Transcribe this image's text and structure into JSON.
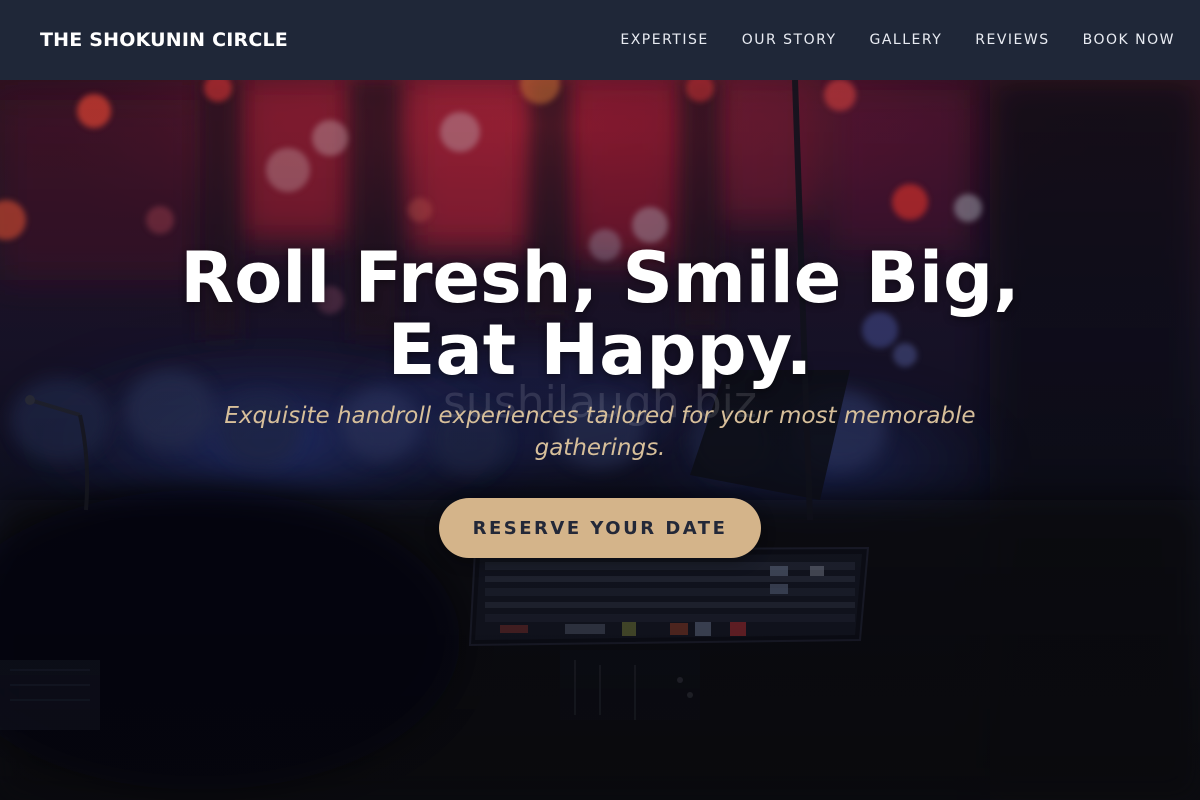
{
  "navbar": {
    "brand": "THE SHOKUNIN CIRCLE",
    "links": [
      "EXPERTISE",
      "OUR STORY",
      "GALLERY",
      "REVIEWS",
      "BOOK NOW"
    ]
  },
  "hero": {
    "title_line1": "Roll Fresh, Smile Big,",
    "title_line2": "Eat Happy.",
    "watermark": "sushilaugh.biz",
    "subtitle": "Exquisite handroll experiences tailored for your most memorable gatherings.",
    "cta_label": "RESERVE YOUR DATE",
    "background_description_icon": "concert-stage-photo"
  },
  "colors": {
    "navbar_bg": "#1f2738",
    "accent": "#d4b48a",
    "subtitle": "#d7bf9a",
    "cta_text": "#232838"
  }
}
